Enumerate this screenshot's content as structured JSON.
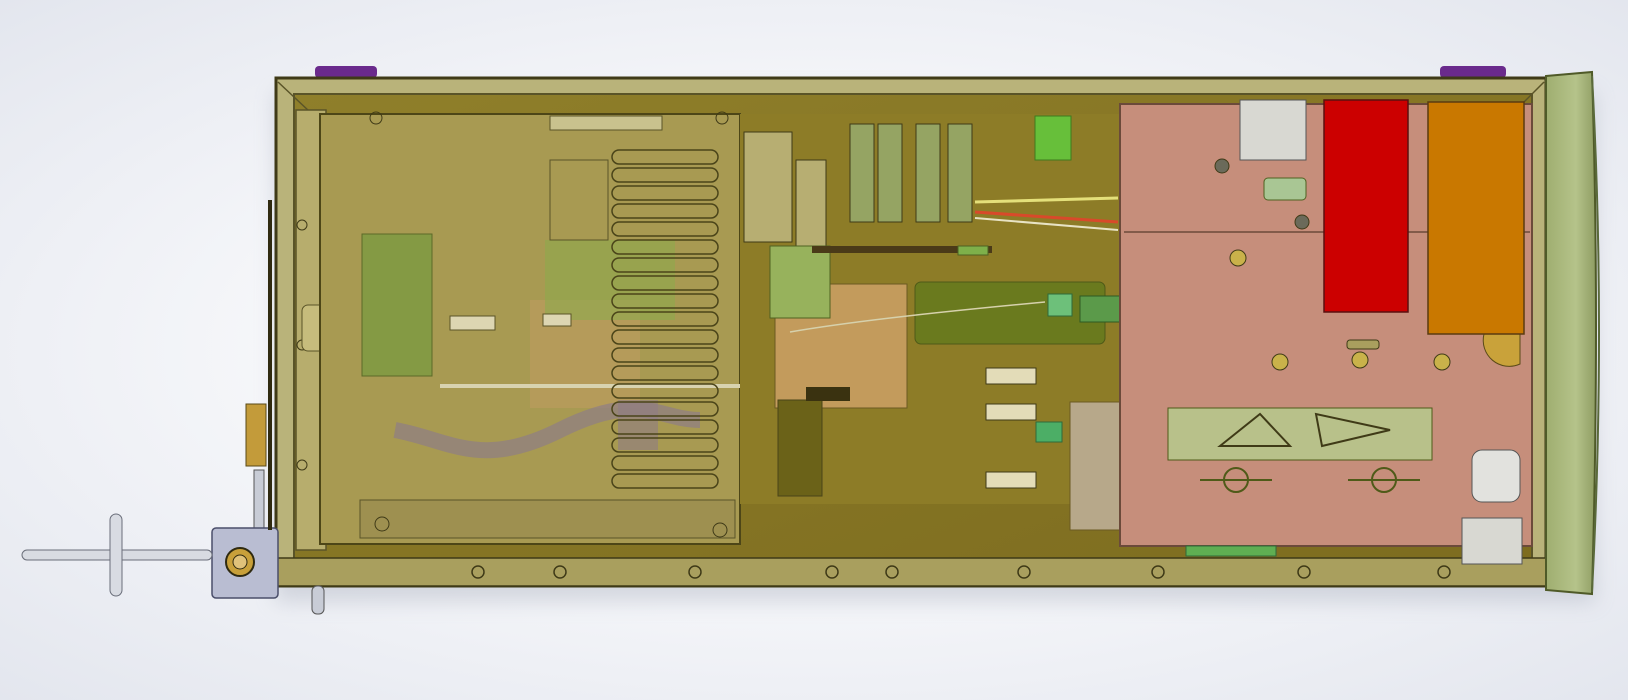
{
  "app": {
    "view": "cad-assembly-viewport",
    "visible_text": []
  },
  "colors": {
    "background": "#eceef3",
    "enclosure_frame": "#b9b37a",
    "enclosure_frame_dark": "#5a5428",
    "front_panel": "#a9b77f",
    "transparent_cover": "#a49755",
    "interior_floor": "#8b7a26",
    "pcb_green": "#7d9a3c",
    "power_plate_pink": "#c68e7b",
    "red_block": "#cc0000",
    "orange_block": "#c97800",
    "grey_block": "#d8d8d2",
    "purple_feet": "#6a2a8c",
    "handle_metal": "#c8ccd6"
  },
  "components": [
    {
      "name": "enclosure-frame",
      "label": ""
    },
    {
      "name": "front-panel",
      "label": ""
    },
    {
      "name": "transparent-top-cover",
      "label": ""
    },
    {
      "name": "heatsink-fins",
      "label": ""
    },
    {
      "name": "green-pcb-board",
      "label": ""
    },
    {
      "name": "connector-array",
      "label": ""
    },
    {
      "name": "power-plate",
      "label": ""
    },
    {
      "name": "red-capacitor-block",
      "label": ""
    },
    {
      "name": "orange-capacitor-block",
      "label": ""
    },
    {
      "name": "side-handle",
      "label": ""
    },
    {
      "name": "mounting-feet",
      "label": ""
    }
  ]
}
